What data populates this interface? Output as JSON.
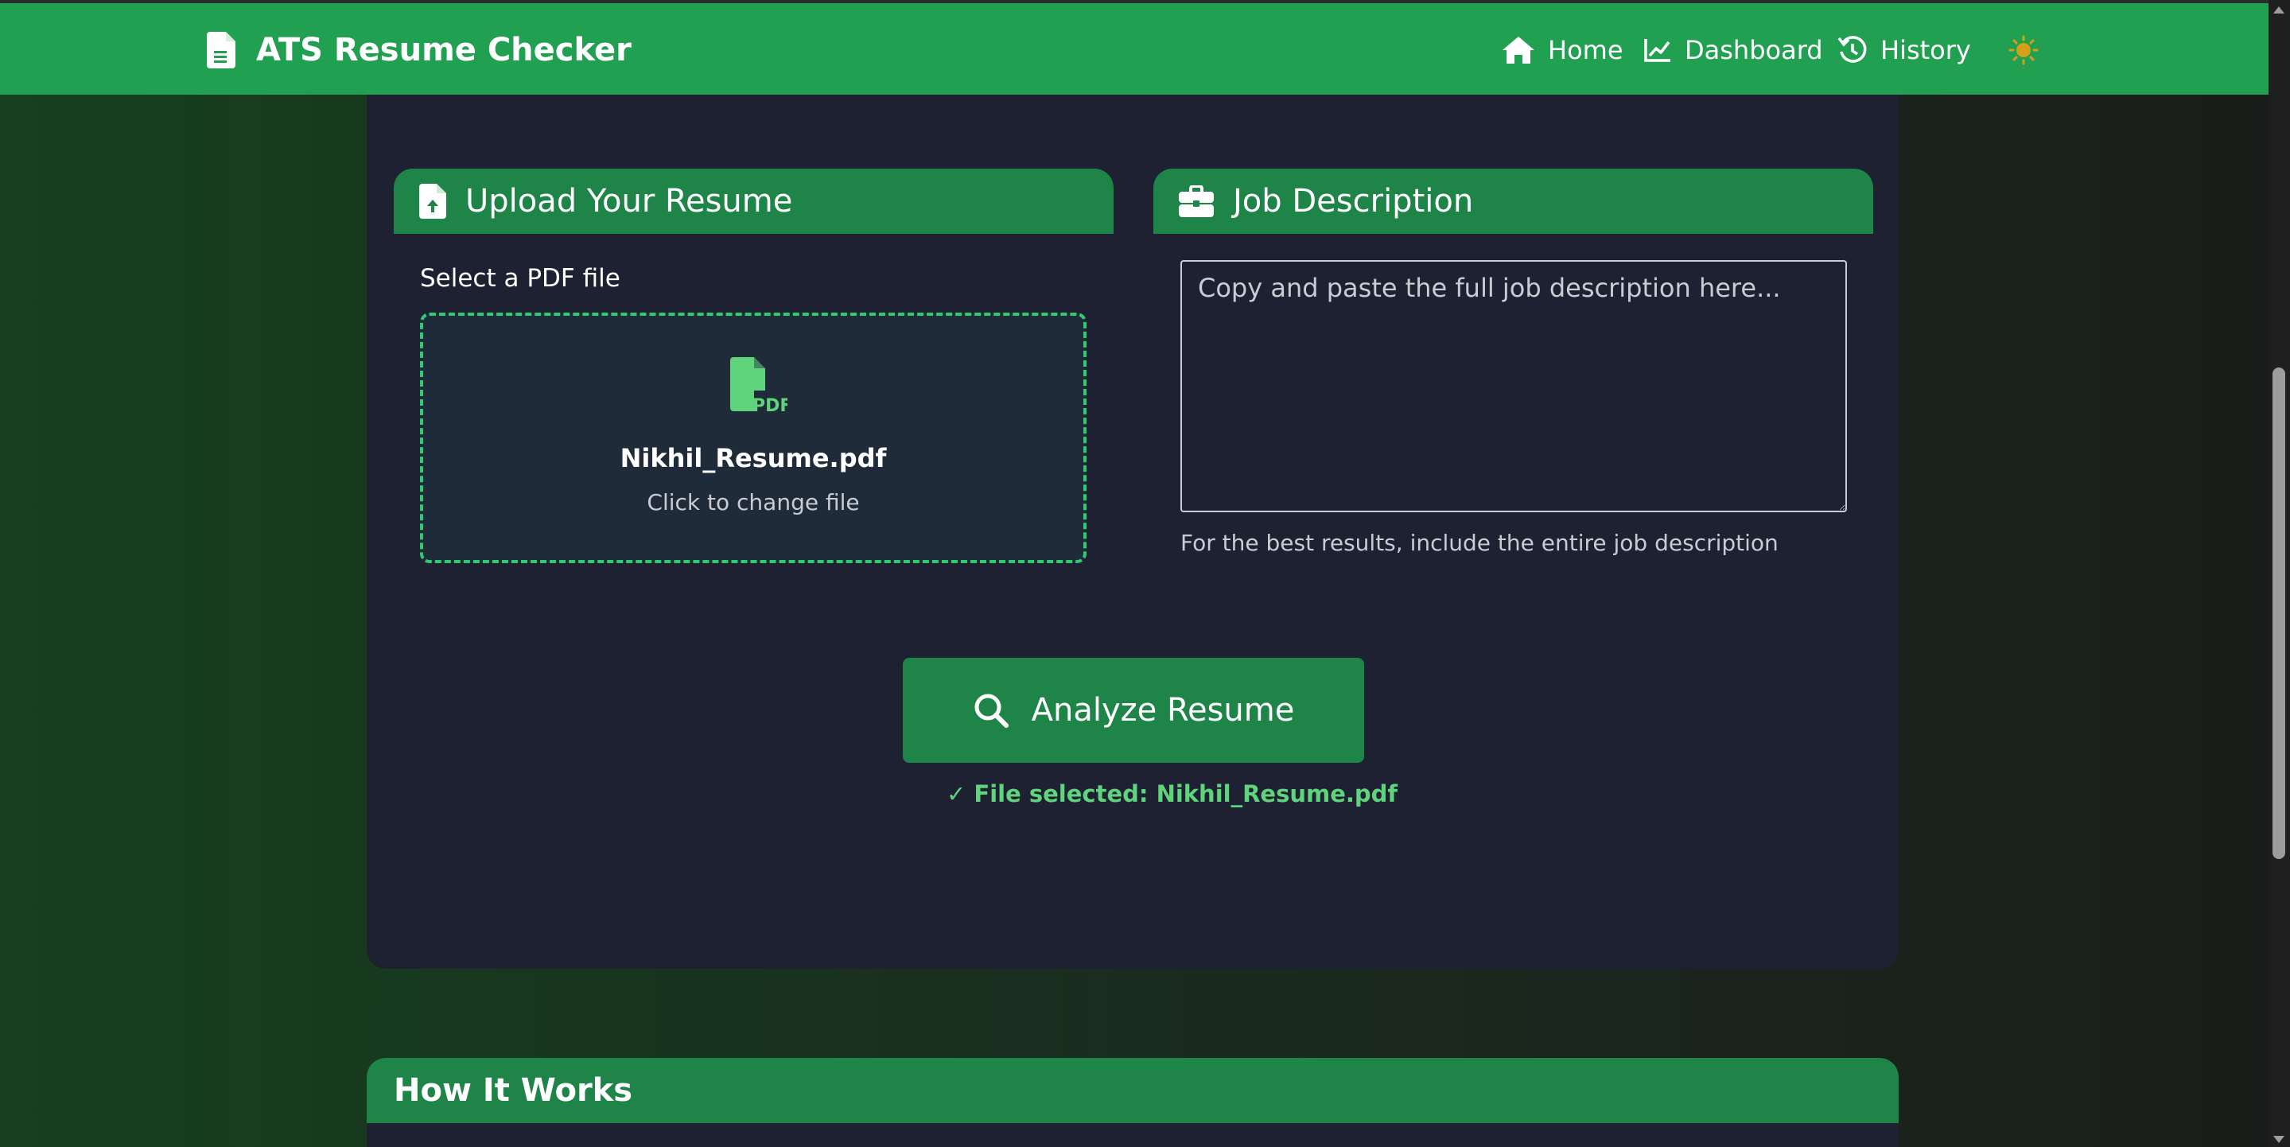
{
  "navbar": {
    "brand": "ATS Resume Checker",
    "items": [
      {
        "label": "Home",
        "icon": "home-icon"
      },
      {
        "label": "Dashboard",
        "icon": "chart-line-icon"
      },
      {
        "label": "History",
        "icon": "history-icon"
      }
    ],
    "theme_icon": "sun-icon"
  },
  "upload": {
    "title": "Upload Your Resume",
    "select_label": "Select a PDF file",
    "file_name": "Nikhil_Resume.pdf",
    "change_hint": "Click to change file"
  },
  "job": {
    "title": "Job Description",
    "placeholder": "Copy and paste the full job description here...",
    "value": "",
    "hint": "For the best results, include the entire job description"
  },
  "analyze": {
    "label": "Analyze Resume",
    "status": "✓ File selected: Nikhil_Resume.pdf"
  },
  "how_it_works": {
    "title": "How It Works"
  },
  "colors": {
    "navbar": "#22a052",
    "panel_header": "#1e8448",
    "card_bg": "#1d2132",
    "accent_green": "#2ecc71",
    "status_green": "#5fd47c",
    "theme_icon": "#d4a017"
  }
}
